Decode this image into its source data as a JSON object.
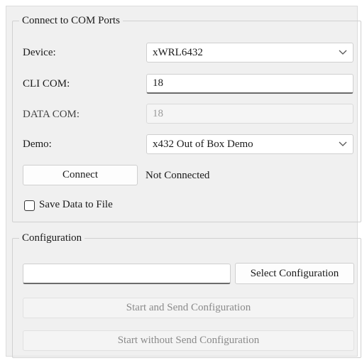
{
  "connect_group": {
    "title": "Connect to COM Ports",
    "device": {
      "label": "Device:",
      "value": "xWRL6432"
    },
    "cli_com": {
      "label": "CLI COM:",
      "value": "18"
    },
    "data_com": {
      "label": "DATA COM:",
      "value": "18"
    },
    "demo": {
      "label": "Demo:",
      "value": "x432 Out of Box Demo"
    },
    "connect_button": "Connect",
    "status": "Not Connected",
    "save_data_label": "Save Data to File",
    "save_data_checked": false
  },
  "config_group": {
    "title": "Configuration",
    "file_path": "",
    "select_button": "Select Configuration",
    "start_send_button": "Start and Send Configuration",
    "start_no_send_button": "Start without Send Configuration"
  }
}
